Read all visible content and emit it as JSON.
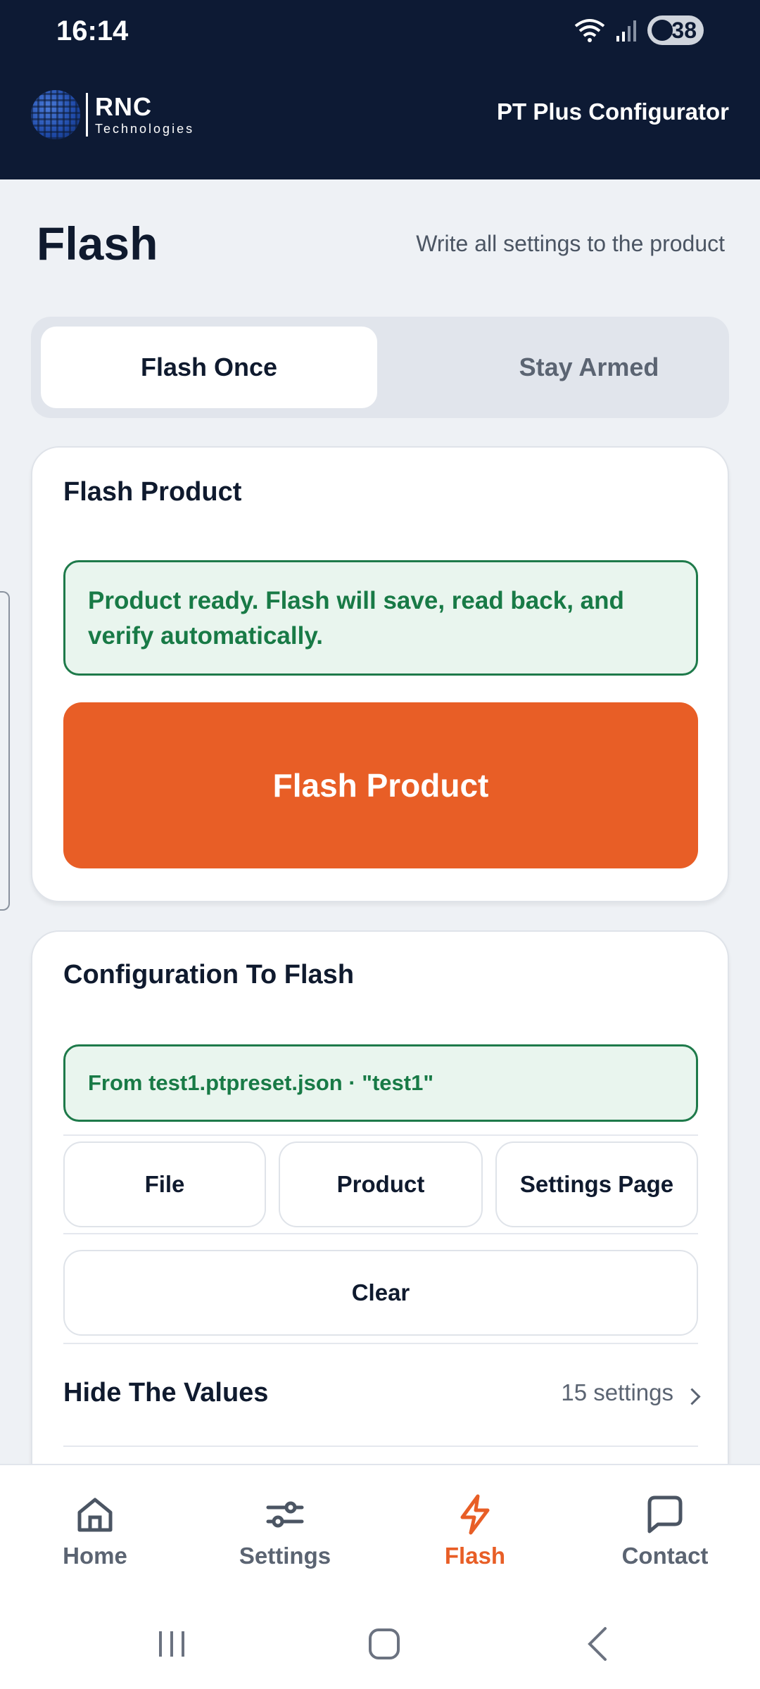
{
  "status_bar": {
    "time": "16:14",
    "battery": "38"
  },
  "header": {
    "brand_name": "RNC",
    "brand_sub": "Technologies",
    "app_title": "PT Plus Configurator"
  },
  "page": {
    "title": "Flash",
    "subtitle": "Write all settings to the product"
  },
  "mode_tabs": [
    {
      "label": "Flash Once",
      "selected": true
    },
    {
      "label": "Stay Armed",
      "selected": false
    }
  ],
  "flash_card": {
    "title": "Flash Product",
    "notice": "Product ready. Flash will save, read back, and verify automatically.",
    "button_label": "Flash Product"
  },
  "config_card": {
    "title": "Configuration To Flash",
    "source": "From test1.ptpreset.json · \"test1\"",
    "sources": {
      "file": "File",
      "product": "Product",
      "settings_page": "Settings Page"
    },
    "clear_label": "Clear",
    "values_row": {
      "label": "Hide The Values",
      "count": "15 settings"
    }
  },
  "bottom_nav": [
    {
      "label": "Home",
      "icon": "home-icon"
    },
    {
      "label": "Settings",
      "icon": "sliders-icon"
    },
    {
      "label": "Flash",
      "icon": "lightning-icon",
      "active": true
    },
    {
      "label": "Contact",
      "icon": "chat-bubble-icon"
    }
  ],
  "colors": {
    "header_bg": "#0d1a34",
    "accent": "#e85e26",
    "success": "#187a46",
    "success_bg": "#e9f5ee"
  }
}
